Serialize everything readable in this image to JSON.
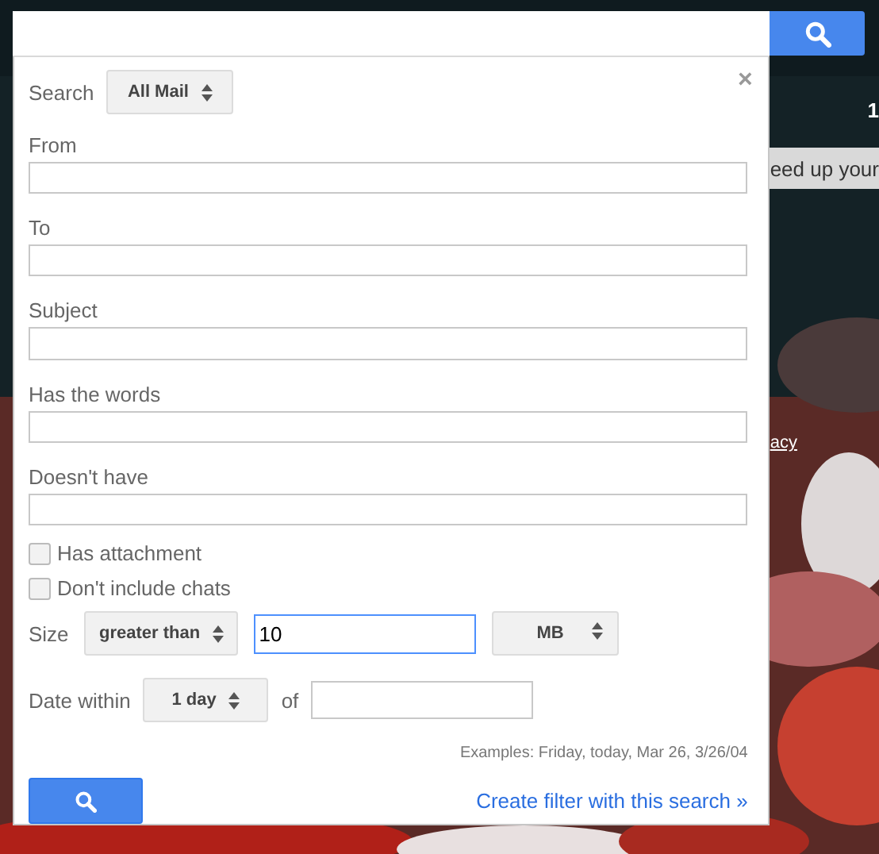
{
  "panel": {
    "close": "×",
    "scope": {
      "label": "Search",
      "value": "All Mail"
    },
    "fields": [
      {
        "label": "From"
      },
      {
        "label": "To"
      },
      {
        "label": "Subject"
      },
      {
        "label": "Has the words"
      },
      {
        "label": "Doesn't have"
      }
    ],
    "checkboxes": [
      {
        "label": "Has attachment",
        "checked": false
      },
      {
        "label": "Don't include chats",
        "checked": false
      }
    ],
    "size": {
      "label": "Size",
      "operator": "greater than",
      "value": "10",
      "unit": "MB"
    },
    "date": {
      "label": "Date within",
      "range": "1 day",
      "of": "of"
    },
    "examples": "Examples: Friday, today, Mar 26, 3/26/04",
    "create_filter": "Create filter with this search »"
  },
  "background": {
    "count": "1",
    "banner": "eed up your",
    "link": "acy"
  }
}
